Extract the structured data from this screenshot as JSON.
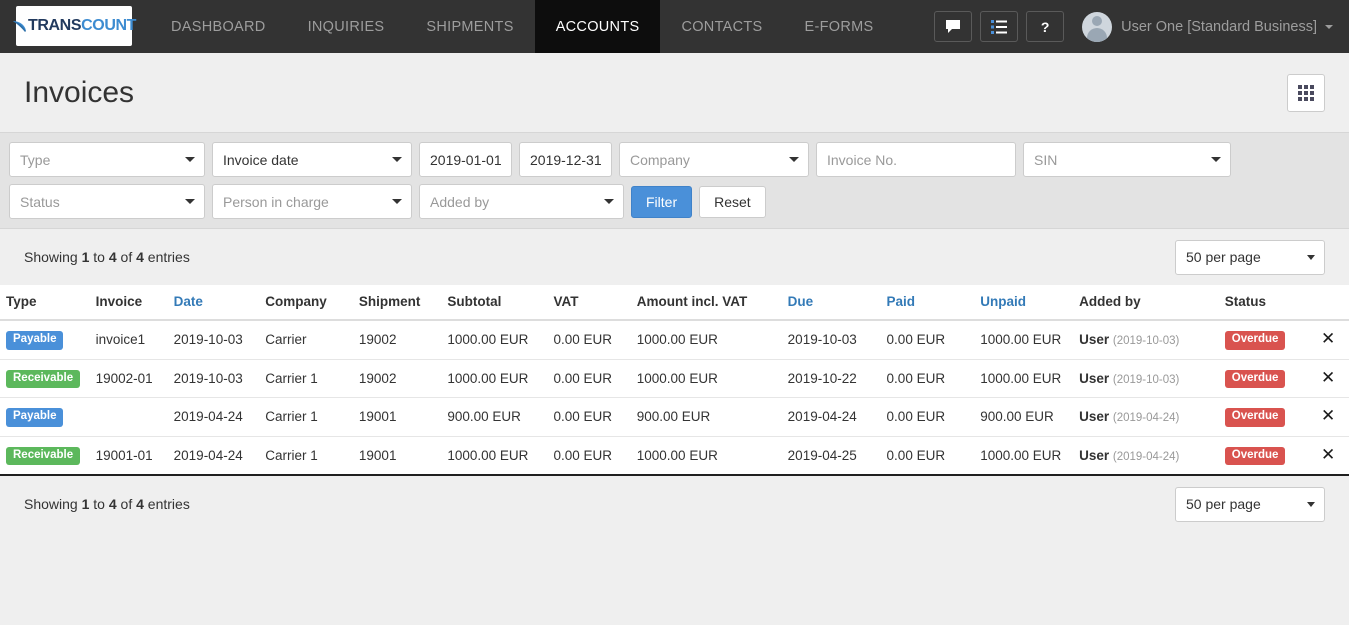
{
  "nav": {
    "brand": {
      "part1": "TRANS",
      "part2": "COUNT",
      "leaf_icon": "leaf-icon"
    },
    "items": [
      {
        "label": "DASHBOARD",
        "active": false
      },
      {
        "label": "INQUIRIES",
        "active": false
      },
      {
        "label": "SHIPMENTS",
        "active": false
      },
      {
        "label": "ACCOUNTS",
        "active": true
      },
      {
        "label": "CONTACTS",
        "active": false
      },
      {
        "label": "E-FORMS",
        "active": false
      }
    ],
    "icons": [
      {
        "name": "chat-icon"
      },
      {
        "name": "list-icon"
      },
      {
        "name": "help-icon",
        "glyph": "?"
      }
    ],
    "user": {
      "name": "User One [Standard Business]",
      "avatar": "avatar-icon"
    }
  },
  "header": {
    "title": "Invoices",
    "grid_button": "grid-view-button"
  },
  "filters": {
    "type": {
      "value": "Type",
      "filled": false
    },
    "date_field": {
      "value": "Invoice date",
      "filled": true
    },
    "date_from": {
      "value": "2019-01-01",
      "filled": true
    },
    "date_to": {
      "value": "2019-12-31",
      "filled": true
    },
    "company": {
      "value": "Company",
      "filled": false
    },
    "invoice_no": {
      "placeholder": "Invoice No.",
      "value": ""
    },
    "sin": {
      "value": "SIN",
      "filled": false
    },
    "status": {
      "value": "Status",
      "filled": false
    },
    "person_in_charge": {
      "value": "Person in charge",
      "filled": false
    },
    "added_by": {
      "value": "Added by",
      "filled": false
    },
    "filter_button": "Filter",
    "reset_button": "Reset"
  },
  "table_meta": {
    "showing_prefix": "Showing ",
    "from": "1",
    "mid1": " to ",
    "to": "4",
    "mid2": " of ",
    "total": "4",
    "suffix": " entries",
    "per_page": "50 per page"
  },
  "table": {
    "columns": [
      {
        "label": "Type",
        "sortable": false
      },
      {
        "label": "Invoice",
        "sortable": false
      },
      {
        "label": "Date",
        "sortable": true
      },
      {
        "label": "Company",
        "sortable": false
      },
      {
        "label": "Shipment",
        "sortable": false
      },
      {
        "label": "Subtotal",
        "sortable": false
      },
      {
        "label": "VAT",
        "sortable": false
      },
      {
        "label": "Amount incl. VAT",
        "sortable": false
      },
      {
        "label": "Due",
        "sortable": true
      },
      {
        "label": "Paid",
        "sortable": true
      },
      {
        "label": "Unpaid",
        "sortable": true
      },
      {
        "label": "Added by",
        "sortable": false
      },
      {
        "label": "Status",
        "sortable": false
      }
    ],
    "rows": [
      {
        "type": "Payable",
        "type_style": "payable",
        "invoice": "invoice1",
        "date": "2019-10-03",
        "company": "Carrier",
        "shipment": "19002",
        "subtotal": "1000.00 EUR",
        "vat": "0.00 EUR",
        "amount": "1000.00 EUR",
        "due": "2019-10-03",
        "paid": "0.00 EUR",
        "unpaid": "1000.00 EUR",
        "added_user": "User",
        "added_date": "(2019-10-03)",
        "status": "Overdue"
      },
      {
        "type": "Receivable",
        "type_style": "receivable",
        "invoice": "19002-01",
        "date": "2019-10-03",
        "company": "Carrier 1",
        "shipment": "19002",
        "subtotal": "1000.00 EUR",
        "vat": "0.00 EUR",
        "amount": "1000.00 EUR",
        "due": "2019-10-22",
        "paid": "0.00 EUR",
        "unpaid": "1000.00 EUR",
        "added_user": "User",
        "added_date": "(2019-10-03)",
        "status": "Overdue"
      },
      {
        "type": "Payable",
        "type_style": "payable",
        "invoice": "",
        "date": "2019-04-24",
        "company": "Carrier 1",
        "shipment": "19001",
        "subtotal": "900.00 EUR",
        "vat": "0.00 EUR",
        "amount": "900.00 EUR",
        "due": "2019-04-24",
        "paid": "0.00 EUR",
        "unpaid": "900.00 EUR",
        "added_user": "User",
        "added_date": "(2019-04-24)",
        "status": "Overdue"
      },
      {
        "type": "Receivable",
        "type_style": "receivable",
        "invoice": "19001-01",
        "date": "2019-04-24",
        "company": "Carrier 1",
        "shipment": "19001",
        "subtotal": "1000.00 EUR",
        "vat": "0.00 EUR",
        "amount": "1000.00 EUR",
        "due": "2019-04-25",
        "paid": "0.00 EUR",
        "unpaid": "1000.00 EUR",
        "added_user": "User",
        "added_date": "(2019-04-24)",
        "status": "Overdue"
      }
    ],
    "delete_glyph": "✕"
  },
  "footer_meta": {
    "showing_prefix": "Showing ",
    "from": "1",
    "mid1": " to ",
    "to": "4",
    "mid2": " of ",
    "total": "4",
    "suffix": " entries",
    "per_page": "50 per page"
  },
  "colors": {
    "navbar": "#333333",
    "nav_active": "#0d0d0d",
    "primary": "#4a90d9",
    "success": "#5cb85c",
    "danger": "#d9534f",
    "link": "#337ab7",
    "money_red": "#e8453c",
    "page_bg": "#efefef",
    "filter_bg": "#e3e3e3"
  }
}
